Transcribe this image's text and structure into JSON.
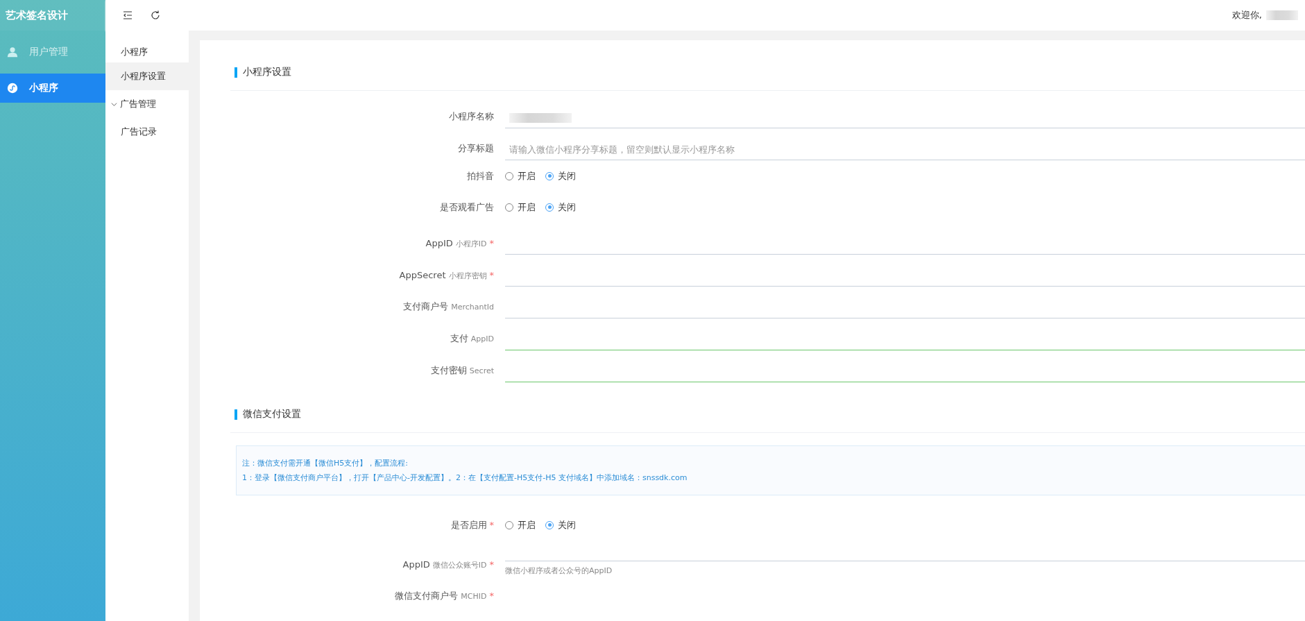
{
  "sidebar": {
    "title": "艺术签名设计",
    "items": [
      {
        "label": "用户管理",
        "kind": "user",
        "selected": false
      },
      {
        "label": "小程序",
        "kind": "miniprogram",
        "selected": true
      }
    ]
  },
  "header": {
    "welcome": "欢迎你,",
    "user_redacted": true
  },
  "subnav": {
    "title": "小程序",
    "items": [
      {
        "label": "小程序设置",
        "selected": true,
        "kind": "link"
      },
      {
        "label": "广告管理",
        "selected": false,
        "kind": "group",
        "expanded": true,
        "children": [
          {
            "label": "广告记录",
            "selected": false
          }
        ]
      }
    ]
  },
  "sections": [
    {
      "title": "小程序设置",
      "fields": [
        {
          "kind": "input",
          "label": "小程序名称",
          "redacted": true,
          "validated": false
        },
        {
          "kind": "input",
          "label": "分享标题",
          "placeholder": "请输入微信小程序分享标题，留空则默认显示小程序名称",
          "validated": false
        },
        {
          "kind": "radio",
          "label": "拍抖音",
          "options": [
            {
              "label": "开启",
              "selected": false
            },
            {
              "label": "关闭",
              "selected": true
            }
          ]
        },
        {
          "kind": "radio",
          "label": "是否观看广告",
          "options": [
            {
              "label": "开启",
              "selected": false
            },
            {
              "label": "关闭",
              "selected": true
            }
          ]
        },
        {
          "kind": "input",
          "label": "AppID",
          "sub": "小程序ID",
          "required_mark": "*",
          "validated": false
        },
        {
          "kind": "input",
          "label": "AppSecret",
          "sub": "小程序密钥",
          "required_mark": "*",
          "validated": false
        },
        {
          "kind": "input",
          "label": "支付商户号",
          "sub": "MerchantId",
          "validated": false
        },
        {
          "kind": "input",
          "label": "支付",
          "sub": "AppID",
          "validated": true
        },
        {
          "kind": "input",
          "label": "支付密钥",
          "sub": "Secret",
          "validated": true
        }
      ]
    },
    {
      "title": "微信支付设置",
      "notice": [
        "注：微信支付需开通【微信H5支付】，配置流程:",
        "1：登录【微信支付商户平台】，打开【产品中心-开发配置】。2：在【支付配置-H5支付-H5 支付域名】中添加域名：snssdk.com"
      ],
      "fields": [
        {
          "kind": "radio",
          "label": "是否启用",
          "required_mark": "*",
          "options": [
            {
              "label": "开启",
              "selected": false
            },
            {
              "label": "关闭",
              "selected": true
            }
          ]
        },
        {
          "kind": "input",
          "label": "AppID",
          "sub": "微信公众账号ID",
          "required_mark": "*",
          "hint": "微信小程序或者公众号的AppID",
          "validated": false
        },
        {
          "kind": "label_only",
          "label": "微信支付商户号",
          "sub": "MCHID",
          "required_mark": "*"
        }
      ]
    }
  ]
}
